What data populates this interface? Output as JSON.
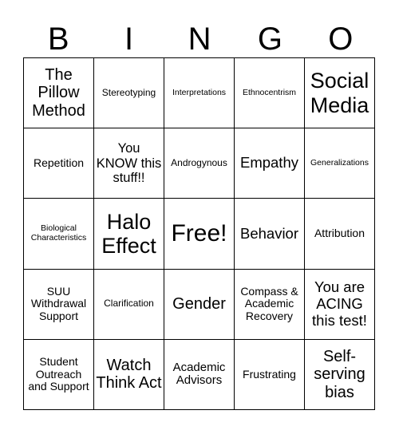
{
  "header": {
    "letters": [
      "B",
      "I",
      "N",
      "G",
      "O"
    ]
  },
  "cells": [
    [
      "The Pillow Method",
      "Stereotyping",
      "Interpretations",
      "Ethnocentrism",
      "Social Media"
    ],
    [
      "Repetition",
      "You KNOW this stuff!!",
      "Androgynous",
      "Empathy",
      "Generalizations"
    ],
    [
      "Biological Characteristics",
      "Halo Effect",
      "Free!",
      "Behavior",
      "Attribution"
    ],
    [
      "SUU Withdrawal Support",
      "Clarification",
      "Gender",
      "Compass & Academic Recovery",
      "You are ACING this test!"
    ],
    [
      "Student Outreach and Support",
      "Watch Think Act",
      "Academic Advisors",
      "Frustrating",
      "Self-serving bias"
    ]
  ]
}
